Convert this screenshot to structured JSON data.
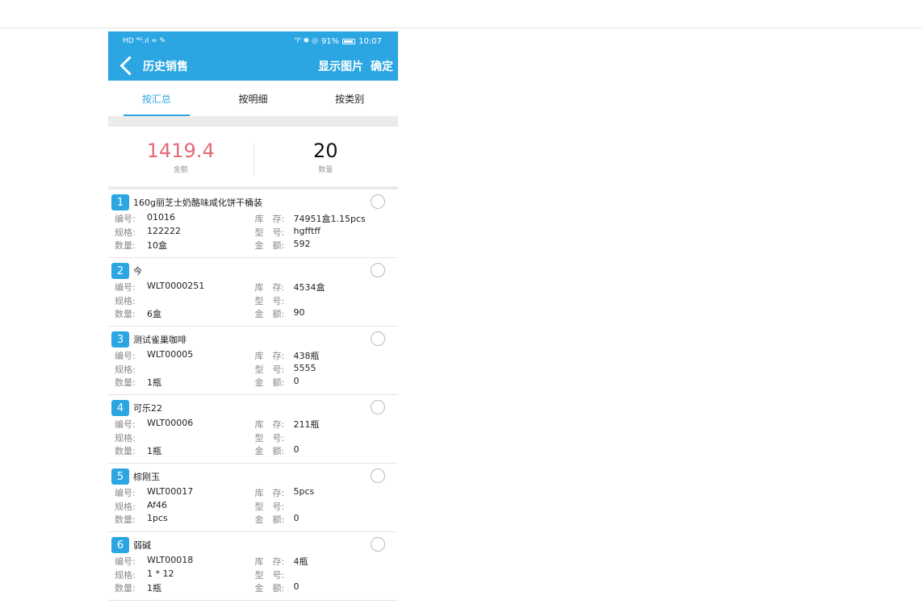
{
  "status_bar": {
    "left": "HD ⁴ᴳ.ıl ≈ ✎",
    "battery_pct": "91%",
    "time": "10:07",
    "icons": "♈ ✱ ◎"
  },
  "navbar": {
    "title": "历史销售",
    "show_images": "显示图片",
    "confirm": "确定"
  },
  "tabs": [
    {
      "label": "按汇总",
      "active": true
    },
    {
      "label": "按明细",
      "active": false
    },
    {
      "label": "按类别",
      "active": false
    }
  ],
  "summary": {
    "amount": "1419.4",
    "amount_label": "金额",
    "qty": "20",
    "qty_label": "数量"
  },
  "labels": {
    "code": "编号:",
    "spec": "规格:",
    "qty": "数量:",
    "stock": "库　存:",
    "model": "型　号:",
    "amount": "金　额:"
  },
  "items": [
    {
      "index": "1",
      "name": "160g丽芝士奶酪味咸化饼干桶装",
      "code": "01016",
      "spec": "122222",
      "qty": "10盒",
      "stock": "74951盒1.15pcs",
      "model": "hgfftff",
      "amount": "592"
    },
    {
      "index": "2",
      "name": "今",
      "code": "WLT0000251",
      "spec": "",
      "qty": "6盒",
      "stock": "4534盒",
      "model": "",
      "amount": "90"
    },
    {
      "index": "3",
      "name": "测试雀巢咖啡",
      "code": "WLT00005",
      "spec": "",
      "qty": "1瓶",
      "stock": "438瓶",
      "model": "5555",
      "amount": "0"
    },
    {
      "index": "4",
      "name": "可乐22",
      "code": "WLT00006",
      "spec": "",
      "qty": "1瓶",
      "stock": "211瓶",
      "model": "",
      "amount": "0"
    },
    {
      "index": "5",
      "name": "棕刚玉",
      "code": "WLT00017",
      "spec": "Af46",
      "qty": "1pcs",
      "stock": "5pcs",
      "model": "",
      "amount": "0"
    },
    {
      "index": "6",
      "name": "弱碱",
      "code": "WLT00018",
      "spec": "1 * 12",
      "qty": "1瓶",
      "stock": "4瓶",
      "model": "",
      "amount": "0"
    }
  ],
  "colors": {
    "primary": "#2ba6e3",
    "amount": "#e36a77"
  }
}
